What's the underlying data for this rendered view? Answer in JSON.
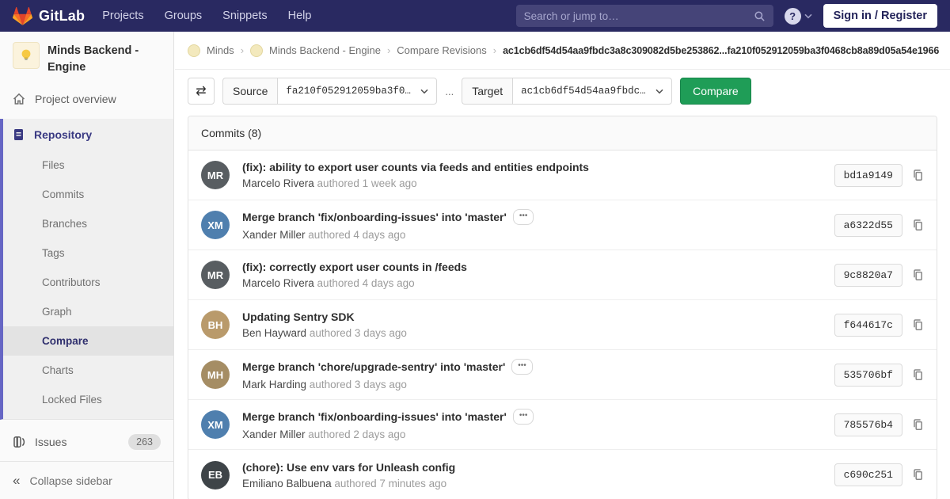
{
  "colors": {
    "navbar_bg": "#292961",
    "accent_indigo": "#6666c4",
    "green": "#1f9d57"
  },
  "navbar": {
    "logo_text": "GitLab",
    "menu": [
      "Projects",
      "Groups",
      "Snippets",
      "Help"
    ],
    "search_placeholder": "Search or jump to…",
    "help_glyph": "?",
    "signin_label": "Sign in / Register"
  },
  "breadcrumb": {
    "group": "Minds",
    "project": "Minds Backend - Engine",
    "section": "Compare Revisions",
    "current": "ac1cb6df54d54aa9fbdc3a8c309082d5be253862...fa210f052912059ba3f0468cb8a89d05a54e1966",
    "separator": "›"
  },
  "sidebar": {
    "project_title": "Minds Backend - Engine",
    "project_overview": "Project overview",
    "repository": "Repository",
    "repo_items": [
      "Files",
      "Commits",
      "Branches",
      "Tags",
      "Contributors",
      "Graph",
      "Compare",
      "Charts",
      "Locked Files"
    ],
    "issues_label": "Issues",
    "issues_count": "263",
    "collapse_label": "Collapse sidebar",
    "collapse_icon": "«"
  },
  "compare_form": {
    "swap_icon": "⇄",
    "source_label": "Source",
    "source_value": "fa210f052912059ba3f0…",
    "separator": "...",
    "target_label": "Target",
    "target_value": "ac1cb6df54d54aa9fbdc…",
    "compare_button": "Compare"
  },
  "commits": {
    "header": "Commits (8)",
    "ellipsis": "•••",
    "items": [
      {
        "title": "(fix): ability to export user counts via feeds and entities endpoints",
        "author": "Marcelo Rivera",
        "time": "authored 1 week ago",
        "sha": "bd1a9149",
        "initials": "MR",
        "avatar_color": "#585d61"
      },
      {
        "title": "Merge branch 'fix/onboarding-issues' into 'master'",
        "author": "Xander Miller",
        "time": "authored 4 days ago",
        "sha": "a6322d55",
        "initials": "XM",
        "avatar_color": "#4f7fae"
      },
      {
        "title": "(fix): correctly export user counts in /feeds",
        "author": "Marcelo Rivera",
        "time": "authored 4 days ago",
        "sha": "9c8820a7",
        "initials": "MR",
        "avatar_color": "#585d61"
      },
      {
        "title": "Updating Sentry SDK",
        "author": "Ben Hayward",
        "time": "authored 3 days ago",
        "sha": "f644617c",
        "initials": "BH",
        "avatar_color": "#b99a6b"
      },
      {
        "title": "Merge branch 'chore/upgrade-sentry' into 'master'",
        "author": "Mark Harding",
        "time": "authored 3 days ago",
        "sha": "535706bf",
        "initials": "MH",
        "avatar_color": "#a58d64"
      },
      {
        "title": "Merge branch 'fix/onboarding-issues' into 'master'",
        "author": "Xander Miller",
        "time": "authored 2 days ago",
        "sha": "785576b4",
        "initials": "XM",
        "avatar_color": "#4f7fae"
      },
      {
        "title": "(chore): Use env vars for Unleash config",
        "author": "Emiliano Balbuena",
        "time": "authored 7 minutes ago",
        "sha": "c690c251",
        "initials": "EB",
        "avatar_color": "#3e4448"
      }
    ]
  }
}
